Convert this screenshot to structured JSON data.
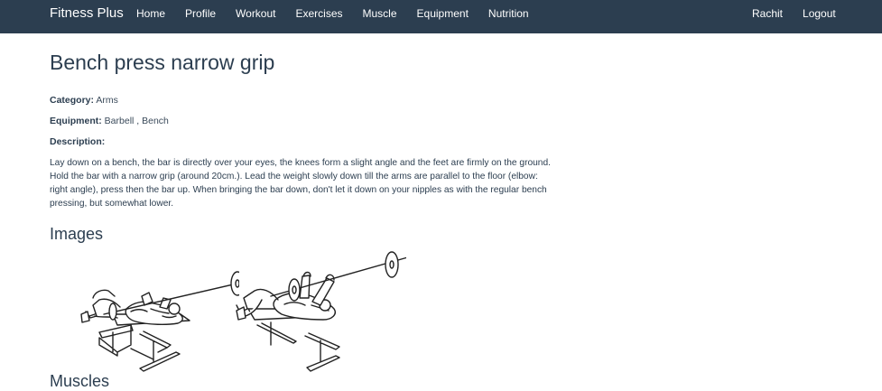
{
  "nav": {
    "brand": "Fitness Plus",
    "links": [
      "Home",
      "Profile",
      "Workout",
      "Exercises",
      "Muscle",
      "Equipment",
      "Nutrition"
    ],
    "user": "Rachit",
    "logout": "Logout"
  },
  "exercise": {
    "title": "Bench press narrow grip",
    "category_label": "Category:",
    "category": "Arms",
    "equipment_label": "Equipment:",
    "equipment": "Barbell , Bench",
    "description_label": "Description:",
    "description": "Lay down on a bench, the bar is directly over your eyes, the knees form a slight angle and the feet are firmly on the ground. Hold the bar with a narrow grip (around 20cm.). Lead the weight slowly down till the arms are parallel to the floor (elbow: right angle), press then the bar up. When bringing the bar down, don't let it down on your nipples as with the regular bench pressing, but somewhat lower."
  },
  "images_heading": "Images",
  "muscles_heading": "Muscles",
  "colors": {
    "navbar": "#2c3e50",
    "text": "#2c3e50"
  }
}
